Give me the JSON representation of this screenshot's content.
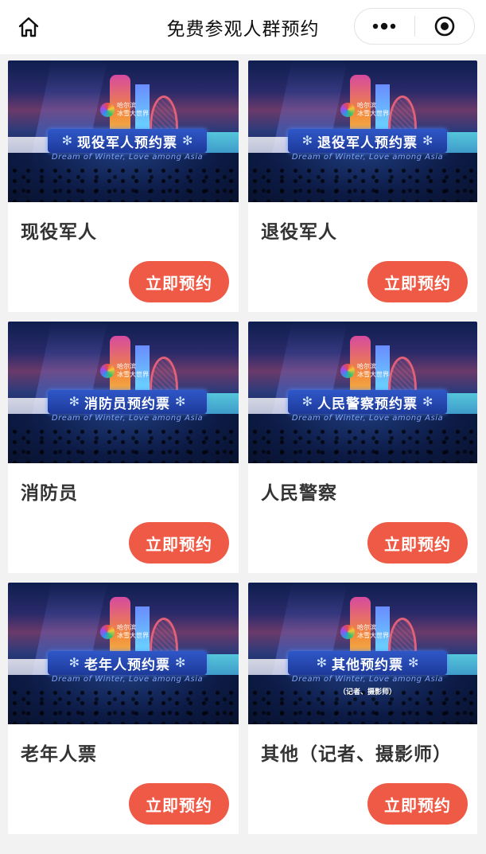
{
  "nav": {
    "title": "免费参观人群预约",
    "home_icon": "home-icon",
    "more_icon": "more-dots-icon",
    "close_icon": "mini-program-close-icon"
  },
  "banner_common": {
    "logo_text_line1": "哈尔滨",
    "logo_text_line2": "冰雪大世界",
    "slogan": "Dream of Winter, Love among Asia"
  },
  "cards": [
    {
      "banner_label": "现役军人预约票",
      "banner_note": "",
      "title": "现役军人",
      "button": "立即预约"
    },
    {
      "banner_label": "退役军人预约票",
      "banner_note": "",
      "title": "退役军人",
      "button": "立即预约"
    },
    {
      "banner_label": "消防员预约票",
      "banner_note": "",
      "title": "消防员",
      "button": "立即预约"
    },
    {
      "banner_label": "人民警察预约票",
      "banner_note": "",
      "title": "人民警察",
      "button": "立即预约"
    },
    {
      "banner_label": "老年人预约票",
      "banner_note": "",
      "title": "老年人票",
      "button": "立即预约"
    },
    {
      "banner_label": "其他预约票",
      "banner_note": "（记者、摄影师）",
      "title": "其他（记者、摄影师）",
      "button": "立即预约"
    }
  ],
  "colors": {
    "accent_button": "#ee5a45",
    "banner_ribbon": "#2f57c8"
  }
}
